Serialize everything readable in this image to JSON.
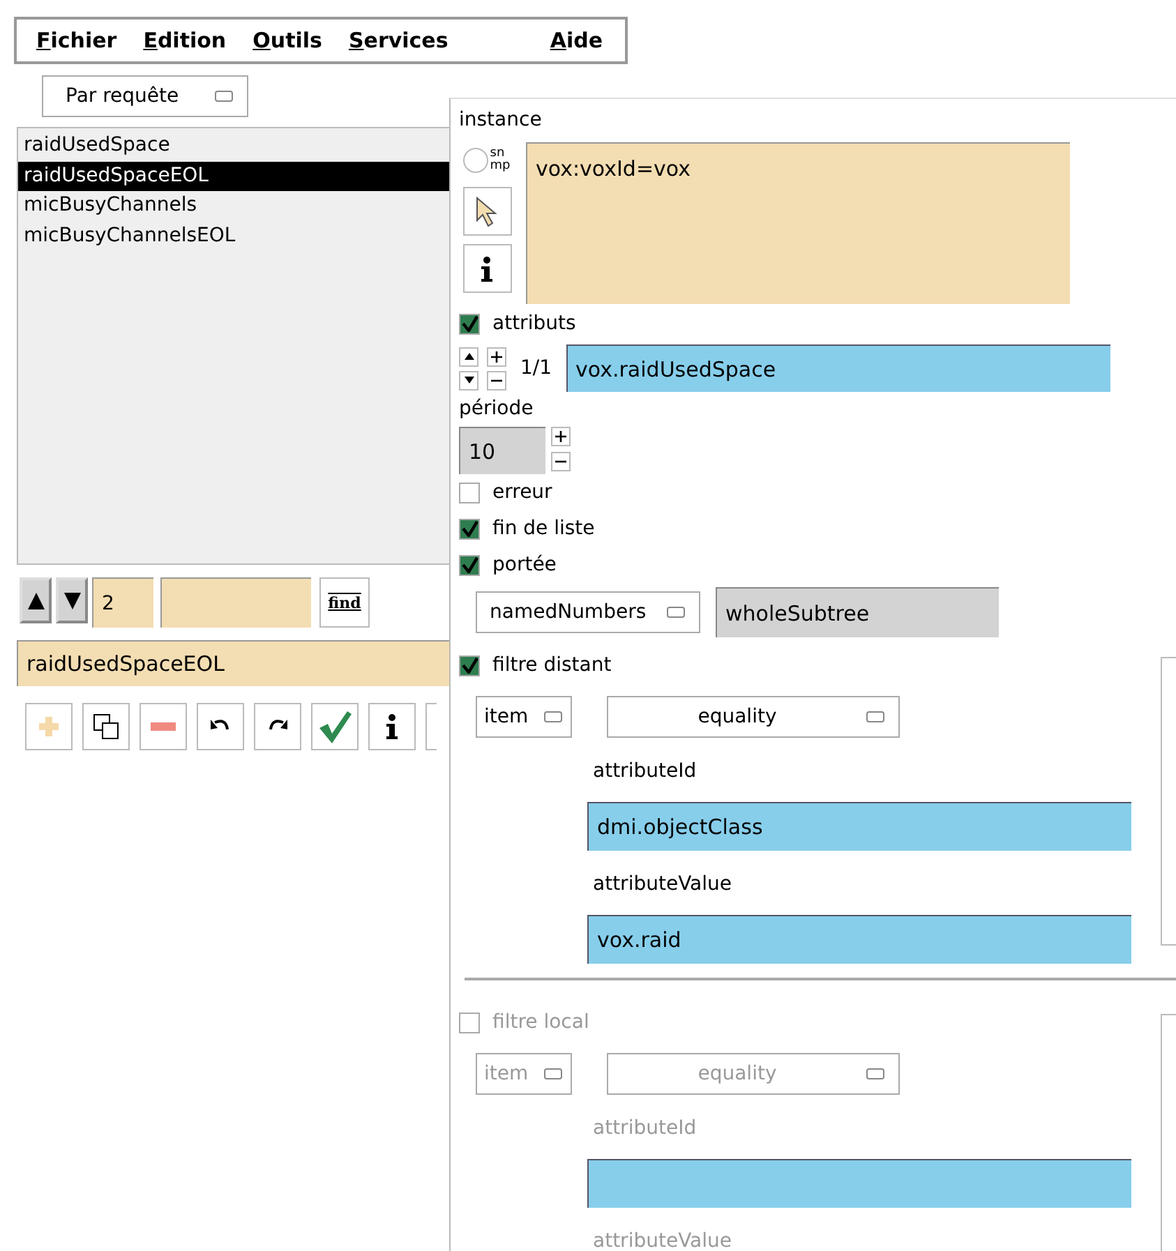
{
  "menu": [
    {
      "label": "Fichier"
    },
    {
      "label": "Edition"
    },
    {
      "label": "Outils"
    },
    {
      "label": "Services"
    },
    {
      "label": "Aide"
    }
  ],
  "mode_select": {
    "value": "Par requête"
  },
  "list": {
    "items": [
      {
        "label": "raidUsedSpace",
        "selected": false
      },
      {
        "label": "raidUsedSpaceEOL",
        "selected": true
      },
      {
        "label": "micBusyChannels",
        "selected": false
      },
      {
        "label": "micBusyChannelsEOL",
        "selected": false
      }
    ]
  },
  "nav": {
    "index": "2",
    "find_label": "find"
  },
  "current_name": "raidUsedSpaceEOL",
  "instance": {
    "label": "instance",
    "snmp_lines": [
      "sn",
      "mp"
    ],
    "snmp_checked": false,
    "value": "vox:voxId=vox"
  },
  "attributs": {
    "label": "attributs",
    "checked": true,
    "counter": "1/1",
    "value": "vox.raidUsedSpace"
  },
  "periode": {
    "label": "période",
    "value": "10"
  },
  "options": [
    {
      "label": "erreur",
      "checked": false
    },
    {
      "label": "fin de liste",
      "checked": true
    },
    {
      "label": "portée",
      "checked": true
    }
  ],
  "scope": {
    "select": "namedNumbers",
    "value": "wholeSubtree"
  },
  "filters": [
    {
      "label": "filtre distant",
      "checked": true,
      "disabled": false,
      "kind_select": "item",
      "match_select": "equality",
      "id_label": "attributeId",
      "id_value": "dmi.objectClass",
      "value_label": "attributeValue",
      "value_value": "vox.raid"
    },
    {
      "label": "filtre local",
      "checked": false,
      "disabled": true,
      "kind_select": "item",
      "match_select": "equality",
      "id_label": "attributeId",
      "value_label": "attributeValue"
    }
  ]
}
